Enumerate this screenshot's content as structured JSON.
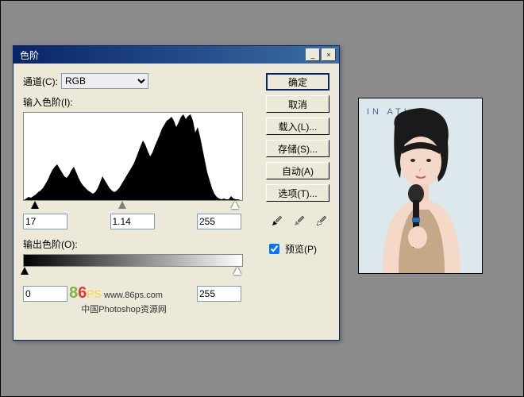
{
  "dialog": {
    "title": "色阶",
    "channel_label": "通道(C):",
    "channel_value": "RGB",
    "input_levels_label": "输入色阶(I):",
    "input_black": "17",
    "input_gamma": "1.14",
    "input_white": "255",
    "output_levels_label": "输出色阶(O):",
    "output_black": "0",
    "output_white": "255"
  },
  "buttons": {
    "ok": "确定",
    "cancel": "取消",
    "load": "载入(L)...",
    "save": "存储(S)...",
    "auto": "自动(A)",
    "options": "选项(T)..."
  },
  "preview": {
    "label": "预览(P)",
    "checked": true
  },
  "watermark": {
    "brand": "86",
    "suffix": "PS",
    "url": "www.86ps.com",
    "tagline": "中国Photoshop资源网"
  },
  "photo_banner_text": "IN      ATI   N"
}
